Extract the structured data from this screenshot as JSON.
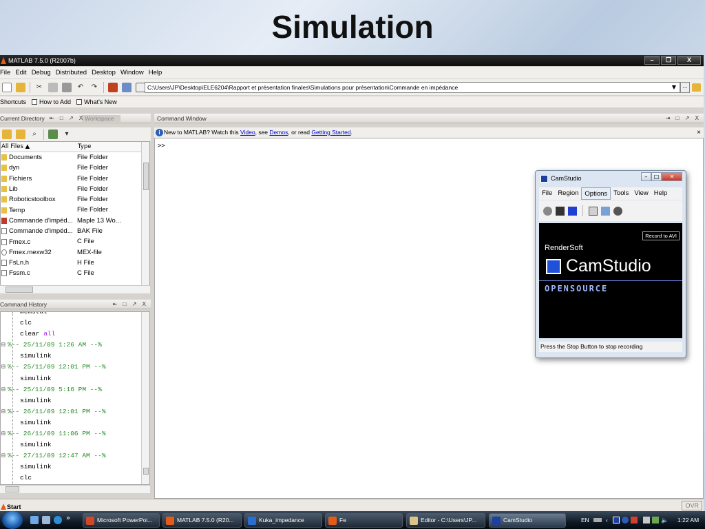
{
  "slide_title": "Simulation",
  "app": {
    "title": "MATLAB 7.5.0 (R2007b)",
    "window_controls": [
      "–",
      "❐",
      "X"
    ],
    "menu": [
      "File",
      "Edit",
      "Debug",
      "Distributed",
      "Desktop",
      "Window",
      "Help"
    ],
    "current_path": "C:\\Users\\JP\\Desktop\\ELE6204\\Rapport et présentation finales\\Simulations pour présentation\\Commande en impédance",
    "browse_label": "...",
    "shortcuts": [
      "Shortcuts",
      "How to Add",
      "What's New"
    ]
  },
  "current_directory": {
    "tab_active": "Current Directory",
    "tab_inactive": "Workspace",
    "controls": "⇤ □ ↗ X",
    "columns": [
      "All Files ▲",
      "Type"
    ],
    "files": [
      {
        "name": "Documents",
        "type": "File Folder",
        "icon": "folder"
      },
      {
        "name": "dyn",
        "type": "File Folder",
        "icon": "folder"
      },
      {
        "name": "Fichiers",
        "type": "File Folder",
        "icon": "folder"
      },
      {
        "name": "Lib",
        "type": "File Folder",
        "icon": "folder"
      },
      {
        "name": "Roboticstoolbox",
        "type": "File Folder",
        "icon": "folder"
      },
      {
        "name": "Temp",
        "type": "File Folder",
        "icon": "folder"
      },
      {
        "name": "Commande d'impéd...",
        "type": "Maple 13 Wo...",
        "icon": "maple"
      },
      {
        "name": "Commande d'impéd...",
        "type": "BAK File",
        "icon": "doc"
      },
      {
        "name": "Fmex.c",
        "type": "C File",
        "icon": "doc"
      },
      {
        "name": "Fmex.mexw32",
        "type": "MEX-file",
        "icon": "mex"
      },
      {
        "name": "FsLn.h",
        "type": "H File",
        "icon": "doc"
      },
      {
        "name": "Fssm.c",
        "type": "C File",
        "icon": "doc"
      }
    ]
  },
  "command_window": {
    "title": "Command Window",
    "controls": "⇥ □ ↗ X",
    "info_prefix": "New to MATLAB? Watch this ",
    "link_video": "Video",
    "info_mid1": ", see ",
    "link_demos": "Demos",
    "info_mid2": ", or read ",
    "link_started": "Getting Started",
    "info_end": ".",
    "prompt": ">>"
  },
  "command_history": {
    "title": "Command History",
    "controls": "⇤ □ ↗ X",
    "entries": [
      {
        "kind": "cmd",
        "text": "memstat"
      },
      {
        "kind": "cmd",
        "text": "clc"
      },
      {
        "kind": "cmd",
        "text": "clear ",
        "kw": "all"
      },
      {
        "kind": "sess",
        "text": "%-- 25/11/09  1:26 AM --%"
      },
      {
        "kind": "cmd",
        "text": "simulink"
      },
      {
        "kind": "sess",
        "text": "%-- 25/11/09 12:01 PM --%"
      },
      {
        "kind": "cmd",
        "text": "simulink"
      },
      {
        "kind": "sess",
        "text": "%-- 25/11/09  5:16 PM --%"
      },
      {
        "kind": "cmd",
        "text": "simulink"
      },
      {
        "kind": "sess",
        "text": "%-- 26/11/09 12:01 PM --%"
      },
      {
        "kind": "cmd",
        "text": "simulink"
      },
      {
        "kind": "sess",
        "text": "%-- 26/11/09 11:06 PM --%"
      },
      {
        "kind": "cmd",
        "text": "simulink"
      },
      {
        "kind": "sess",
        "text": "%-- 27/11/09 12:47 AM --%"
      },
      {
        "kind": "cmd",
        "text": "simulink"
      },
      {
        "kind": "cmd",
        "text": "clc"
      }
    ]
  },
  "status": {
    "start": "Start",
    "ovr": "OVR"
  },
  "camstudio": {
    "title": "CamStudio",
    "menu": [
      "File",
      "Region",
      "Options",
      "Tools",
      "View",
      "Help"
    ],
    "selected_menu": "Options",
    "record_label": "Record to AVI",
    "brand": "RenderSoft",
    "name": "CamStudio",
    "tagline": "OPENSOURCE",
    "status": "Press the Stop Button to stop recording"
  },
  "taskbar": {
    "overflow": "»",
    "items": [
      {
        "label": "Microsoft PowerPoi...",
        "color": "#d24726"
      },
      {
        "label": "MATLAB 7.5.0 (R20...",
        "color": "#e25b18"
      },
      {
        "label": "Kuka_impedance",
        "color": "#2a6fd0"
      },
      {
        "label": "Fe",
        "color": "#e25b18"
      },
      {
        "label": "Editor - C:\\Users\\JP...",
        "color": "#d9c48a"
      },
      {
        "label": "CamStudio",
        "color": "#1c3fa0"
      }
    ],
    "lang": "EN",
    "time": "1:22 AM"
  }
}
